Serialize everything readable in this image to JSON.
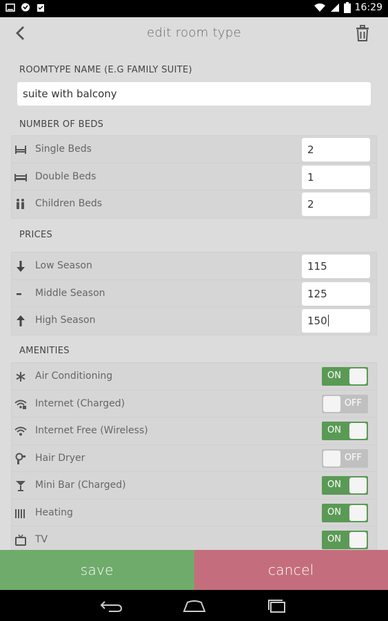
{
  "statusbar": {
    "time": "16:29"
  },
  "header": {
    "title": "edit room type"
  },
  "roomtype": {
    "label": "ROOMTYPE NAME (E.G FAMILY SUITE)",
    "value": "suite with balcony"
  },
  "beds": {
    "label": "NUMBER OF BEDS",
    "items": [
      {
        "icon": "single-bed-icon",
        "label": "Single Beds",
        "value": "2"
      },
      {
        "icon": "double-bed-icon",
        "label": "Double Beds",
        "value": "1"
      },
      {
        "icon": "children-icon",
        "label": "Children Beds",
        "value": "2"
      }
    ]
  },
  "prices": {
    "label": "PRICES",
    "items": [
      {
        "icon": "arrow-down-icon",
        "label": "Low Season",
        "value": "115"
      },
      {
        "icon": "minus-icon",
        "label": "Middle Season",
        "value": "125"
      },
      {
        "icon": "arrow-up-icon",
        "label": "High Season",
        "value": "150"
      }
    ]
  },
  "amenities": {
    "label": "AMENITIES",
    "items": [
      {
        "icon": "snowflake-icon",
        "label": "Air Conditioning",
        "state": "ON"
      },
      {
        "icon": "wifi-charged-icon",
        "label": "Internet (Charged)",
        "state": "OFF"
      },
      {
        "icon": "wifi-icon",
        "label": "Internet Free (Wireless)",
        "state": "ON"
      },
      {
        "icon": "hair-dryer-icon",
        "label": "Hair Dryer",
        "state": "OFF"
      },
      {
        "icon": "cocktail-icon",
        "label": "Mini Bar (Charged)",
        "state": "ON"
      },
      {
        "icon": "heater-icon",
        "label": "Heating",
        "state": "ON"
      },
      {
        "icon": "tv-icon",
        "label": "TV",
        "state": "ON"
      }
    ]
  },
  "footer": {
    "save_label": "save",
    "cancel_label": "cancel"
  },
  "colors": {
    "toggle_on": "#5a9a55",
    "toggle_off": "#c0c0c0",
    "save": "#6fab6b",
    "cancel": "#c46e7d"
  }
}
